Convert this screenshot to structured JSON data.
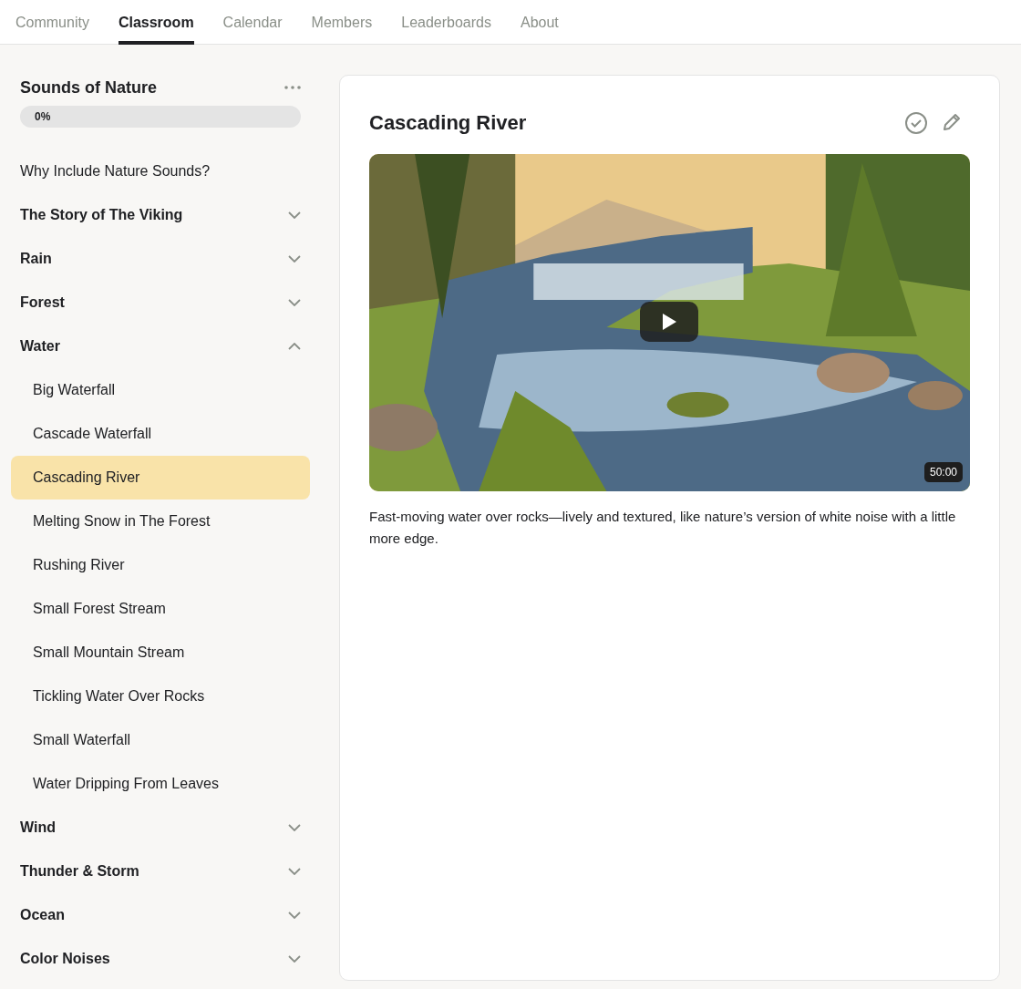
{
  "nav": {
    "tabs": [
      {
        "label": "Community",
        "selected": false
      },
      {
        "label": "Classroom",
        "selected": true
      },
      {
        "label": "Calendar",
        "selected": false
      },
      {
        "label": "Members",
        "selected": false
      },
      {
        "label": "Leaderboards",
        "selected": false
      },
      {
        "label": "About",
        "selected": false
      }
    ]
  },
  "course": {
    "title": "Sounds of Nature",
    "progress": {
      "level": 0,
      "reading": "0%"
    }
  },
  "sidebar": {
    "items": [
      {
        "kind": "lesson",
        "label": "Why Include Nature Sounds?",
        "selected": false
      },
      {
        "kind": "module",
        "label": "The Story of The Viking",
        "expanded": false
      },
      {
        "kind": "module",
        "label": "Rain",
        "expanded": false
      },
      {
        "kind": "module",
        "label": "Forest",
        "expanded": false
      },
      {
        "kind": "module",
        "label": "Water",
        "expanded": true,
        "children": [
          {
            "label": "Big Waterfall",
            "selected": false
          },
          {
            "label": "Cascade Waterfall",
            "selected": false
          },
          {
            "label": "Cascading River",
            "selected": true
          },
          {
            "label": "Melting Snow in The Forest",
            "selected": false
          },
          {
            "label": "Rushing River",
            "selected": false
          },
          {
            "label": "Small Forest Stream",
            "selected": false
          },
          {
            "label": "Small Mountain Stream",
            "selected": false
          },
          {
            "label": "Tickling Water Over Rocks",
            "selected": false
          },
          {
            "label": "Small Waterfall",
            "selected": false
          },
          {
            "label": "Water Dripping From Leaves",
            "selected": false
          }
        ]
      },
      {
        "kind": "module",
        "label": "Wind",
        "expanded": false
      },
      {
        "kind": "module",
        "label": "Thunder & Storm",
        "expanded": false
      },
      {
        "kind": "module",
        "label": "Ocean",
        "expanded": false
      },
      {
        "kind": "module",
        "label": "Color Noises",
        "expanded": false
      }
    ]
  },
  "lesson": {
    "title": "Cascading River",
    "video": {
      "kind": "picture",
      "duration": "50:00"
    },
    "description": "Fast-moving water over rocks—lively and textured, like nature’s version of white noise with a little more edge."
  }
}
